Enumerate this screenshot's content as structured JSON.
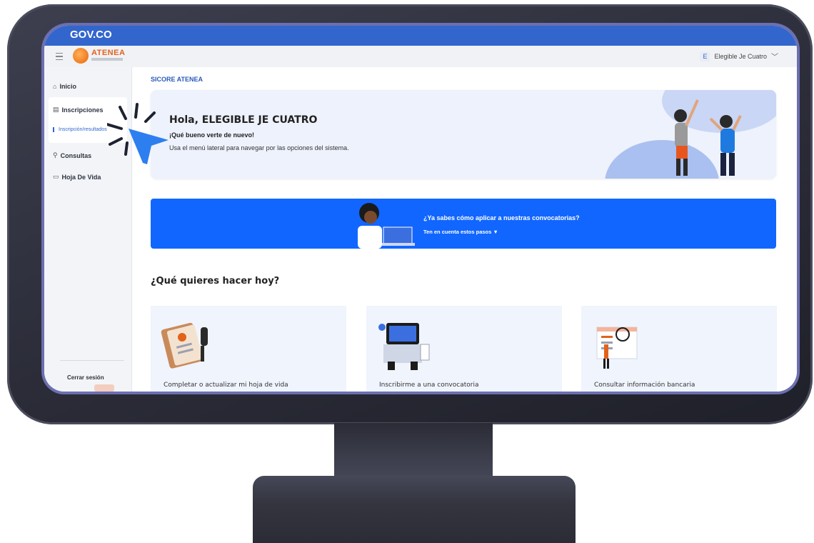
{
  "gov": {
    "text": "GOV.CO"
  },
  "app": {
    "logo_text": "ATENEA"
  },
  "user": {
    "initial": "E",
    "name": "Elegible Je Cuatro"
  },
  "sidebar": {
    "items": [
      {
        "label": "Inicio",
        "icon": "home-icon"
      },
      {
        "label": "Inscripciones",
        "icon": "list-icon"
      },
      {
        "label": "Inscripción/resultados",
        "icon": ""
      },
      {
        "label": "Consultas",
        "icon": "search-icon"
      },
      {
        "label": "Hoja De Vida",
        "icon": "id-card-icon"
      }
    ],
    "logout": "Cerrar sesión"
  },
  "main": {
    "breadcrumb": "SICORE ATENEA",
    "welcome": {
      "title": "Hola, ELEGIBLE JE CUATRO",
      "subtitle": "¡Qué bueno verte de nuevo!",
      "desc": "Usa el menú lateral para navegar por las opciones del sistema."
    },
    "banner": {
      "title": "¿Ya sabes cómo aplicar a nuestras convocatorias?",
      "link": "Ten en cuenta estos pasos ▼"
    },
    "section_title": "¿Qué quieres hacer hoy?",
    "cards": [
      {
        "label": "Completar o actualizar mi hoja de vida"
      },
      {
        "label": "Inscribirme a una convocatoria"
      },
      {
        "label": "Consultar información bancaria"
      }
    ]
  },
  "colors": {
    "accent": "#3366cc",
    "banner": "#1166ff",
    "bezel": "#2b2c38"
  }
}
